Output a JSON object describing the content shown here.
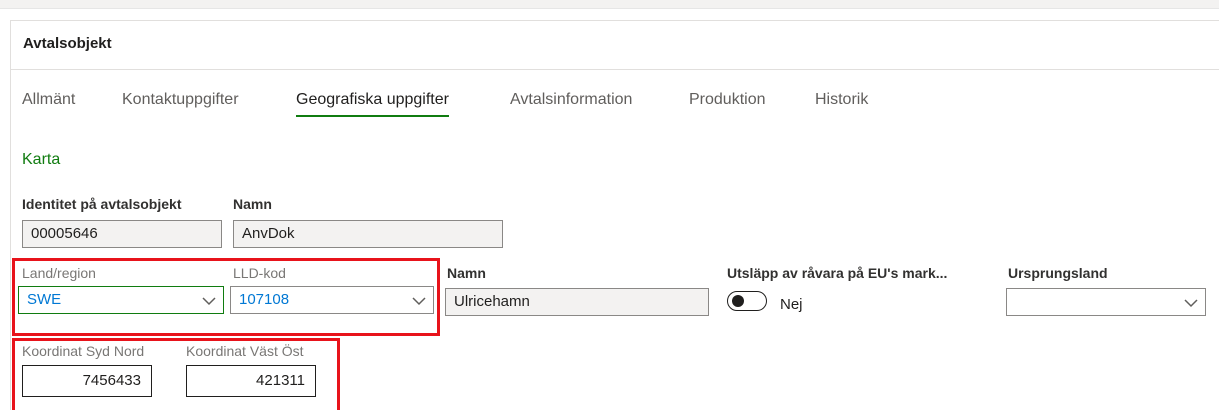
{
  "section": {
    "title": "Avtalsobjekt"
  },
  "tabs": [
    {
      "label": "Allmänt"
    },
    {
      "label": "Kontaktuppgifter"
    },
    {
      "label": "Geografiska uppgifter"
    },
    {
      "label": "Avtalsinformation"
    },
    {
      "label": "Produktion"
    },
    {
      "label": "Historik"
    }
  ],
  "active_tab": "Geografiska uppgifter",
  "karta_link": "Karta",
  "identity": {
    "label": "Identitet på avtalsobjekt",
    "value": "00005646"
  },
  "name_top": {
    "label": "Namn",
    "value": "AnvDok"
  },
  "land_region": {
    "label": "Land/region",
    "value": "SWE"
  },
  "lld_kod": {
    "label": "LLD-kod",
    "value": "107108"
  },
  "name_region": {
    "label": "Namn",
    "value": "Ulricehamn"
  },
  "utslapp": {
    "label": "Utsläpp av råvara på EU's mark...",
    "toggle_text": "Nej",
    "checked": false
  },
  "ursprungsland": {
    "label": "Ursprungsland",
    "value": ""
  },
  "koordinat_syd_nord": {
    "label": "Koordinat Syd Nord",
    "value": "7456433"
  },
  "koordinat_vast_ost": {
    "label": "Koordinat Väst Öst",
    "value": "421311"
  },
  "colors": {
    "accent_green": "#107c10",
    "link_blue": "#0078d4",
    "highlight_red": "#e8131b"
  }
}
